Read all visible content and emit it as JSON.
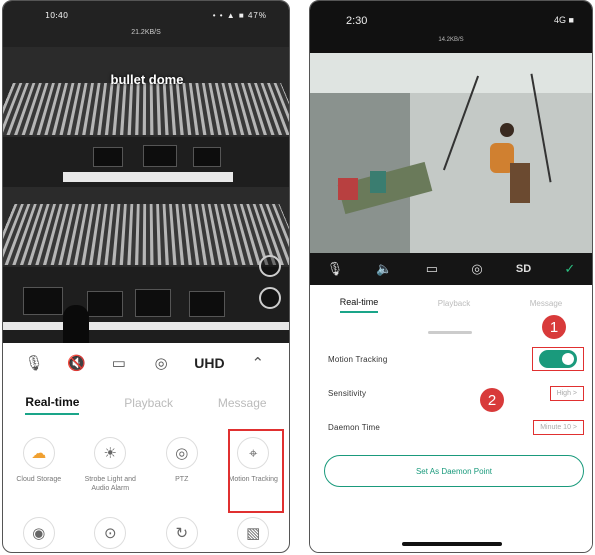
{
  "left": {
    "status": {
      "time": "10:40",
      "icons": "• • ▲ ■ 47%",
      "speed": "21.2KB/S"
    },
    "camera_title": "bullet dome",
    "toolbar": {
      "mic": "🎙",
      "mute": "🔇",
      "record": "▭",
      "snapshot": "◎",
      "quality": "UHD",
      "more": "⌃"
    },
    "tabs": [
      "Real-time",
      "Playback",
      "Message"
    ],
    "features": [
      {
        "icon": "☁",
        "label": "Cloud Storage"
      },
      {
        "icon": "☀",
        "label": "Strobe Light and Audio Alarm"
      },
      {
        "icon": "◎",
        "label": "PTZ"
      },
      {
        "icon": "⌖",
        "label": "Motion Tracking"
      }
    ],
    "row2_icons": [
      "◉",
      "⊙",
      "↻",
      "▧"
    ]
  },
  "right": {
    "status": {
      "time": "2:30",
      "icons": "4G ■",
      "speed": "14.2KB/S"
    },
    "toolbar": {
      "mic": "🎙",
      "speaker": "🔈",
      "record": "▭",
      "snapshot": "◎",
      "quality": "SD",
      "ok": "✓"
    },
    "tabs": [
      "Real-time",
      "Playback",
      "Message"
    ],
    "settings": {
      "motion_label": "Motion Tracking",
      "sensitivity_label": "Sensitivity",
      "sensitivity_value": "High >",
      "daemon_label": "Daemon Time",
      "daemon_value": "Minute 10 >",
      "daemon_button": "Set As Daemon Point"
    },
    "badges": {
      "one": "1",
      "two": "2"
    }
  },
  "colors": {
    "accent": "#1a9a7c",
    "highlight": "#e03030"
  }
}
